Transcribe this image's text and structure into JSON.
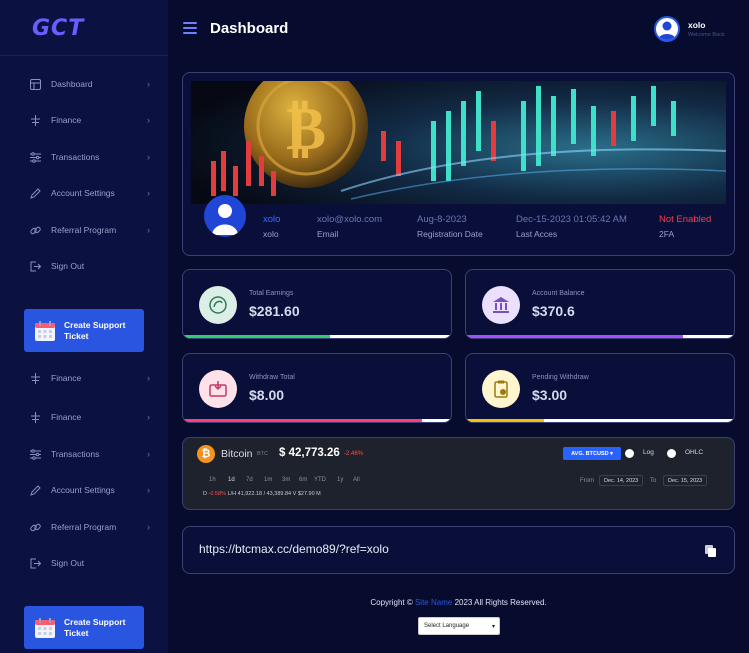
{
  "brand": {
    "logo_text": "GCT"
  },
  "header": {
    "title": "Dashboard",
    "user_name": "xolo",
    "user_greeting": "Welcome Back"
  },
  "sidebar": {
    "items_top": [
      {
        "label": "Dashboard",
        "icon": "dashboard-icon"
      },
      {
        "label": "Finance",
        "icon": "finance-icon"
      },
      {
        "label": "Transactions",
        "icon": "transactions-icon"
      },
      {
        "label": "Account Settings",
        "icon": "pencil-icon"
      },
      {
        "label": "Referral Program",
        "icon": "link-icon"
      },
      {
        "label": "Sign Out",
        "icon": "sign-out-icon"
      }
    ],
    "items_bottom": [
      {
        "label": "Finance",
        "icon": "finance-icon"
      },
      {
        "label": "Finance",
        "icon": "finance-icon"
      },
      {
        "label": "Transactions",
        "icon": "transactions-icon"
      },
      {
        "label": "Account Settings",
        "icon": "pencil-icon"
      },
      {
        "label": "Referral Program",
        "icon": "link-icon"
      },
      {
        "label": "Sign Out",
        "icon": "sign-out-icon"
      }
    ],
    "ticket_line1": "Create Support",
    "ticket_line2": "Ticket"
  },
  "profile": {
    "name": "xolo",
    "name_label": "xolo",
    "email": "xolo@xolo.com",
    "email_label": "Email",
    "reg_date": "Aug-8-2023",
    "reg_label": "Registration Date",
    "last_access": "Dec-15-2023 01:05:42 AM",
    "last_access_label": "Last Acces",
    "twofa_status": "Not Enabled",
    "twofa_label": "2FA"
  },
  "stats": [
    {
      "label": "Total Earnings",
      "value": "$281.60",
      "icon": "earnings-icon",
      "accent": "#2ecc71",
      "progress": 0.55
    },
    {
      "label": "Account Balance",
      "value": "$370.6",
      "icon": "bank-icon",
      "accent": "#a64dff",
      "progress": 0.81
    },
    {
      "label": "Withdraw Total",
      "value": "$8.00",
      "icon": "withdraw-icon",
      "accent": "#ff3b7a",
      "progress": 0.89
    },
    {
      "label": "Pending Withdraw",
      "value": "$3.00",
      "icon": "pending-icon",
      "accent": "#f5c400",
      "progress": 0.29
    }
  ],
  "ticker": {
    "coin": "Bitcoin",
    "symbol": "BTC",
    "price": "$ 42,773.26",
    "change": "-2.46%",
    "pair": "AVG. BTCUSD",
    "opt_log": "Log",
    "opt_ohlc": "OHLC",
    "ranges": [
      "1h",
      "1d",
      "7d",
      "1m",
      "3m",
      "6m",
      "YTD",
      "1y",
      "All"
    ],
    "stats_d": "D",
    "stats_pct": "-0.58%",
    "stats_lh": "L/H 41,922.18 / 43,389.84",
    "stats_v": "V $27.90 M",
    "from_label": "From",
    "from_date": "Dec. 14, 2023",
    "to_label": "To",
    "to_date": "Dec. 15, 2023"
  },
  "referral": {
    "link": "https://btcmax.cc/demo89/?ref=xolo"
  },
  "footer": {
    "prefix": "Copyright ©",
    "site_name": "Site Name",
    "suffix": "2023 All Rights Reserved.",
    "language": "Select Language"
  }
}
